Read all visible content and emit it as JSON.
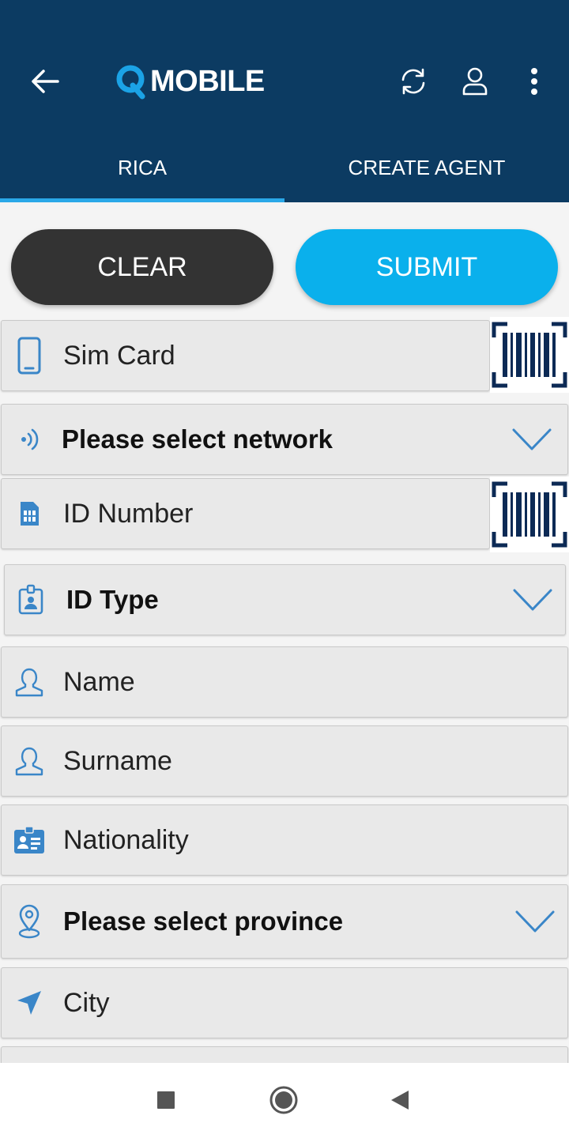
{
  "header": {
    "logo_text": "MOBILE",
    "back_icon": "arrow-left-icon",
    "actions": [
      "refresh-icon",
      "user-icon",
      "more-vertical-icon"
    ]
  },
  "tabs": [
    {
      "label": "RICA",
      "active": true
    },
    {
      "label": "CREATE AGENT",
      "active": false
    }
  ],
  "buttons": {
    "clear_label": "CLEAR",
    "submit_label": "SUBMIT"
  },
  "form": {
    "sim_card": {
      "placeholder": "Sim Card",
      "icon": "phone-icon",
      "action_icon": "barcode-scan-icon"
    },
    "network": {
      "value": "Please select network",
      "icon": "signal-icon"
    },
    "id_number": {
      "placeholder": "ID Number",
      "icon": "sim-chip-icon",
      "action_icon": "barcode-scan-icon"
    },
    "id_type": {
      "value": "ID Type",
      "icon": "id-badge-icon"
    },
    "name": {
      "placeholder": "Name",
      "icon": "person-icon"
    },
    "surname": {
      "placeholder": "Surname",
      "icon": "person-icon"
    },
    "nationality": {
      "placeholder": "Nationality",
      "icon": "id-card-icon"
    },
    "province": {
      "value": "Please select province",
      "icon": "location-pin-icon"
    },
    "city": {
      "placeholder": "City",
      "icon": "navigation-arrow-icon"
    }
  },
  "colors": {
    "appbar": "#0c3b62",
    "tab_indicator": "#2aa8e8",
    "clear_button": "#333333",
    "submit_button": "#0ab0ec",
    "icon_blue": "#3a86c8",
    "barcode": "#0c2a55"
  },
  "system_nav": [
    "recents-square-icon",
    "home-circle-icon",
    "back-triangle-icon"
  ]
}
